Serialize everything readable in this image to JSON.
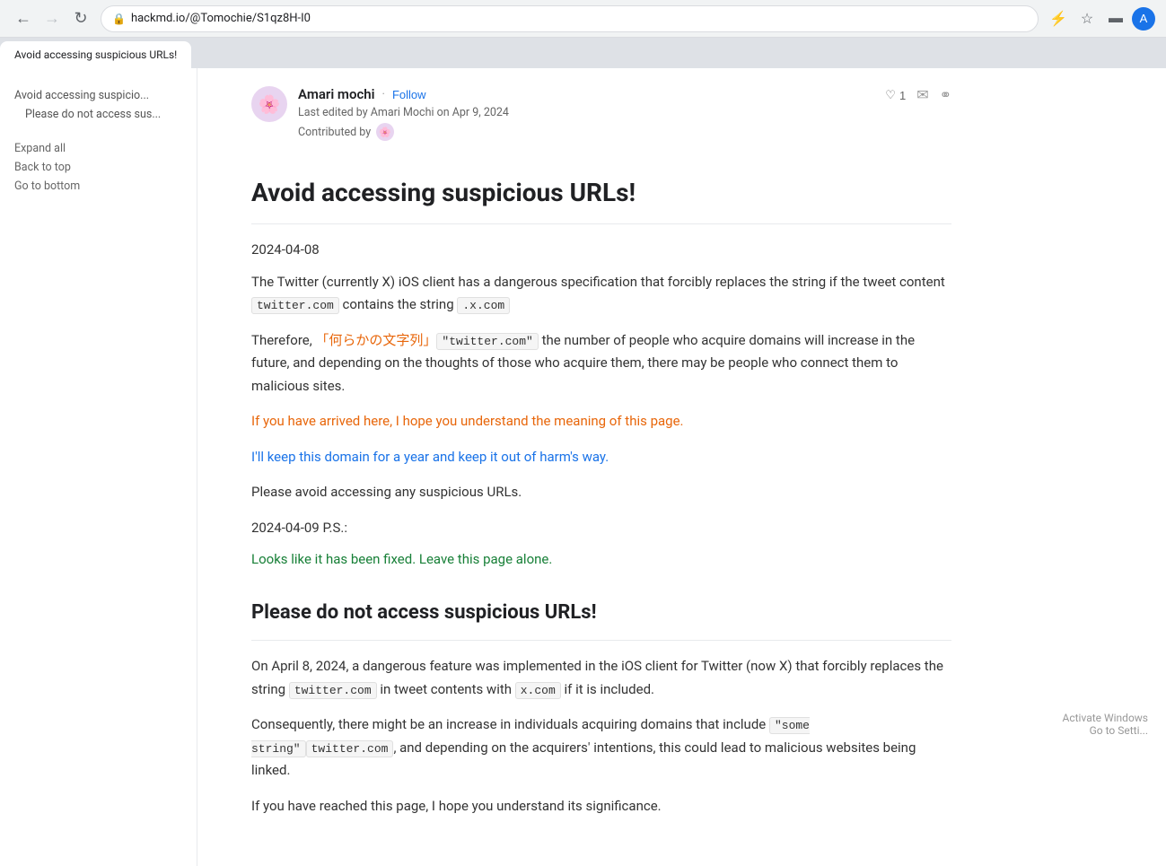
{
  "browser": {
    "tab_title": "Avoid accessing suspicious URLs!",
    "url": "hackmd.io/@Tomochie/S1qz8H-I0",
    "back_disabled": false,
    "forward_disabled": false
  },
  "sidebar": {
    "toc_items": [
      {
        "label": "Avoid accessing suspicio...",
        "indent": false
      },
      {
        "label": "Please do not access sus...",
        "indent": true
      }
    ],
    "actions": [
      {
        "label": "Expand all"
      },
      {
        "label": "Back to top"
      },
      {
        "label": "Go to bottom"
      }
    ]
  },
  "author": {
    "name": "Amari mochi",
    "follow_separator": "·",
    "follow_label": "Follow",
    "last_edited": "Last edited by Amari Mochi on Apr 9, 2024",
    "contributed_by_label": "Contributed by",
    "like_count": "1",
    "avatar_emoji": "🌸",
    "contrib_avatar_emoji": "🌸"
  },
  "article": {
    "title": "Avoid accessing suspicious URLs!",
    "section1": {
      "date": "2024-04-08",
      "para1_before": "The Twitter (currently X) iOS client has a dangerous specification that forcibly replaces the string if the tweet content ",
      "code1": "twitter.com",
      "para1_after": " contains the string ",
      "code2": ".x.com",
      "para2_before": "Therefore, ",
      "inline_quote": "「何らかの文字列」",
      "code3": "\"twitter.com\"",
      "para2_after": " the number of people who acquire domains will increase in the future, and depending on the thoughts of those who acquire them, there may be people who connect them to malicious sites.",
      "orange_para": "If you have arrived here, I hope you understand the meaning of this page.",
      "blue_para1_before": "I'll keep this domain for a year and ",
      "blue_link": "keep it out of harm's way.",
      "blue_para1_after": "",
      "blue_para2": "Please avoid accessing any suspicious URLs.",
      "date2": "2024-04-09 P.S.:",
      "green_para": "Looks like it has been fixed. Leave this page alone."
    },
    "section2": {
      "title": "Please do not access suspicious URLs!",
      "para1": "On April 8, 2024, a dangerous feature was implemented in the iOS client for Twitter (now X) that forcibly replaces the string ",
      "code1": "twitter.com",
      "para1_mid": " in tweet contents with ",
      "code2": "x.com",
      "para1_end": " if it is included.",
      "para2_before": "Consequently, there might be an increase in individuals acquiring domains that include ",
      "code_some_string": "\"some string\"",
      "code_twitter_com": "twitter.com",
      "para2_after": ", and depending on the acquirers' intentions, this could lead to malicious websites being linked.",
      "para3": "If you have reached this page, I hope you understand its significance."
    }
  },
  "activate_windows": {
    "line1": "Activate Windows",
    "line2": "Go to Setti..."
  }
}
